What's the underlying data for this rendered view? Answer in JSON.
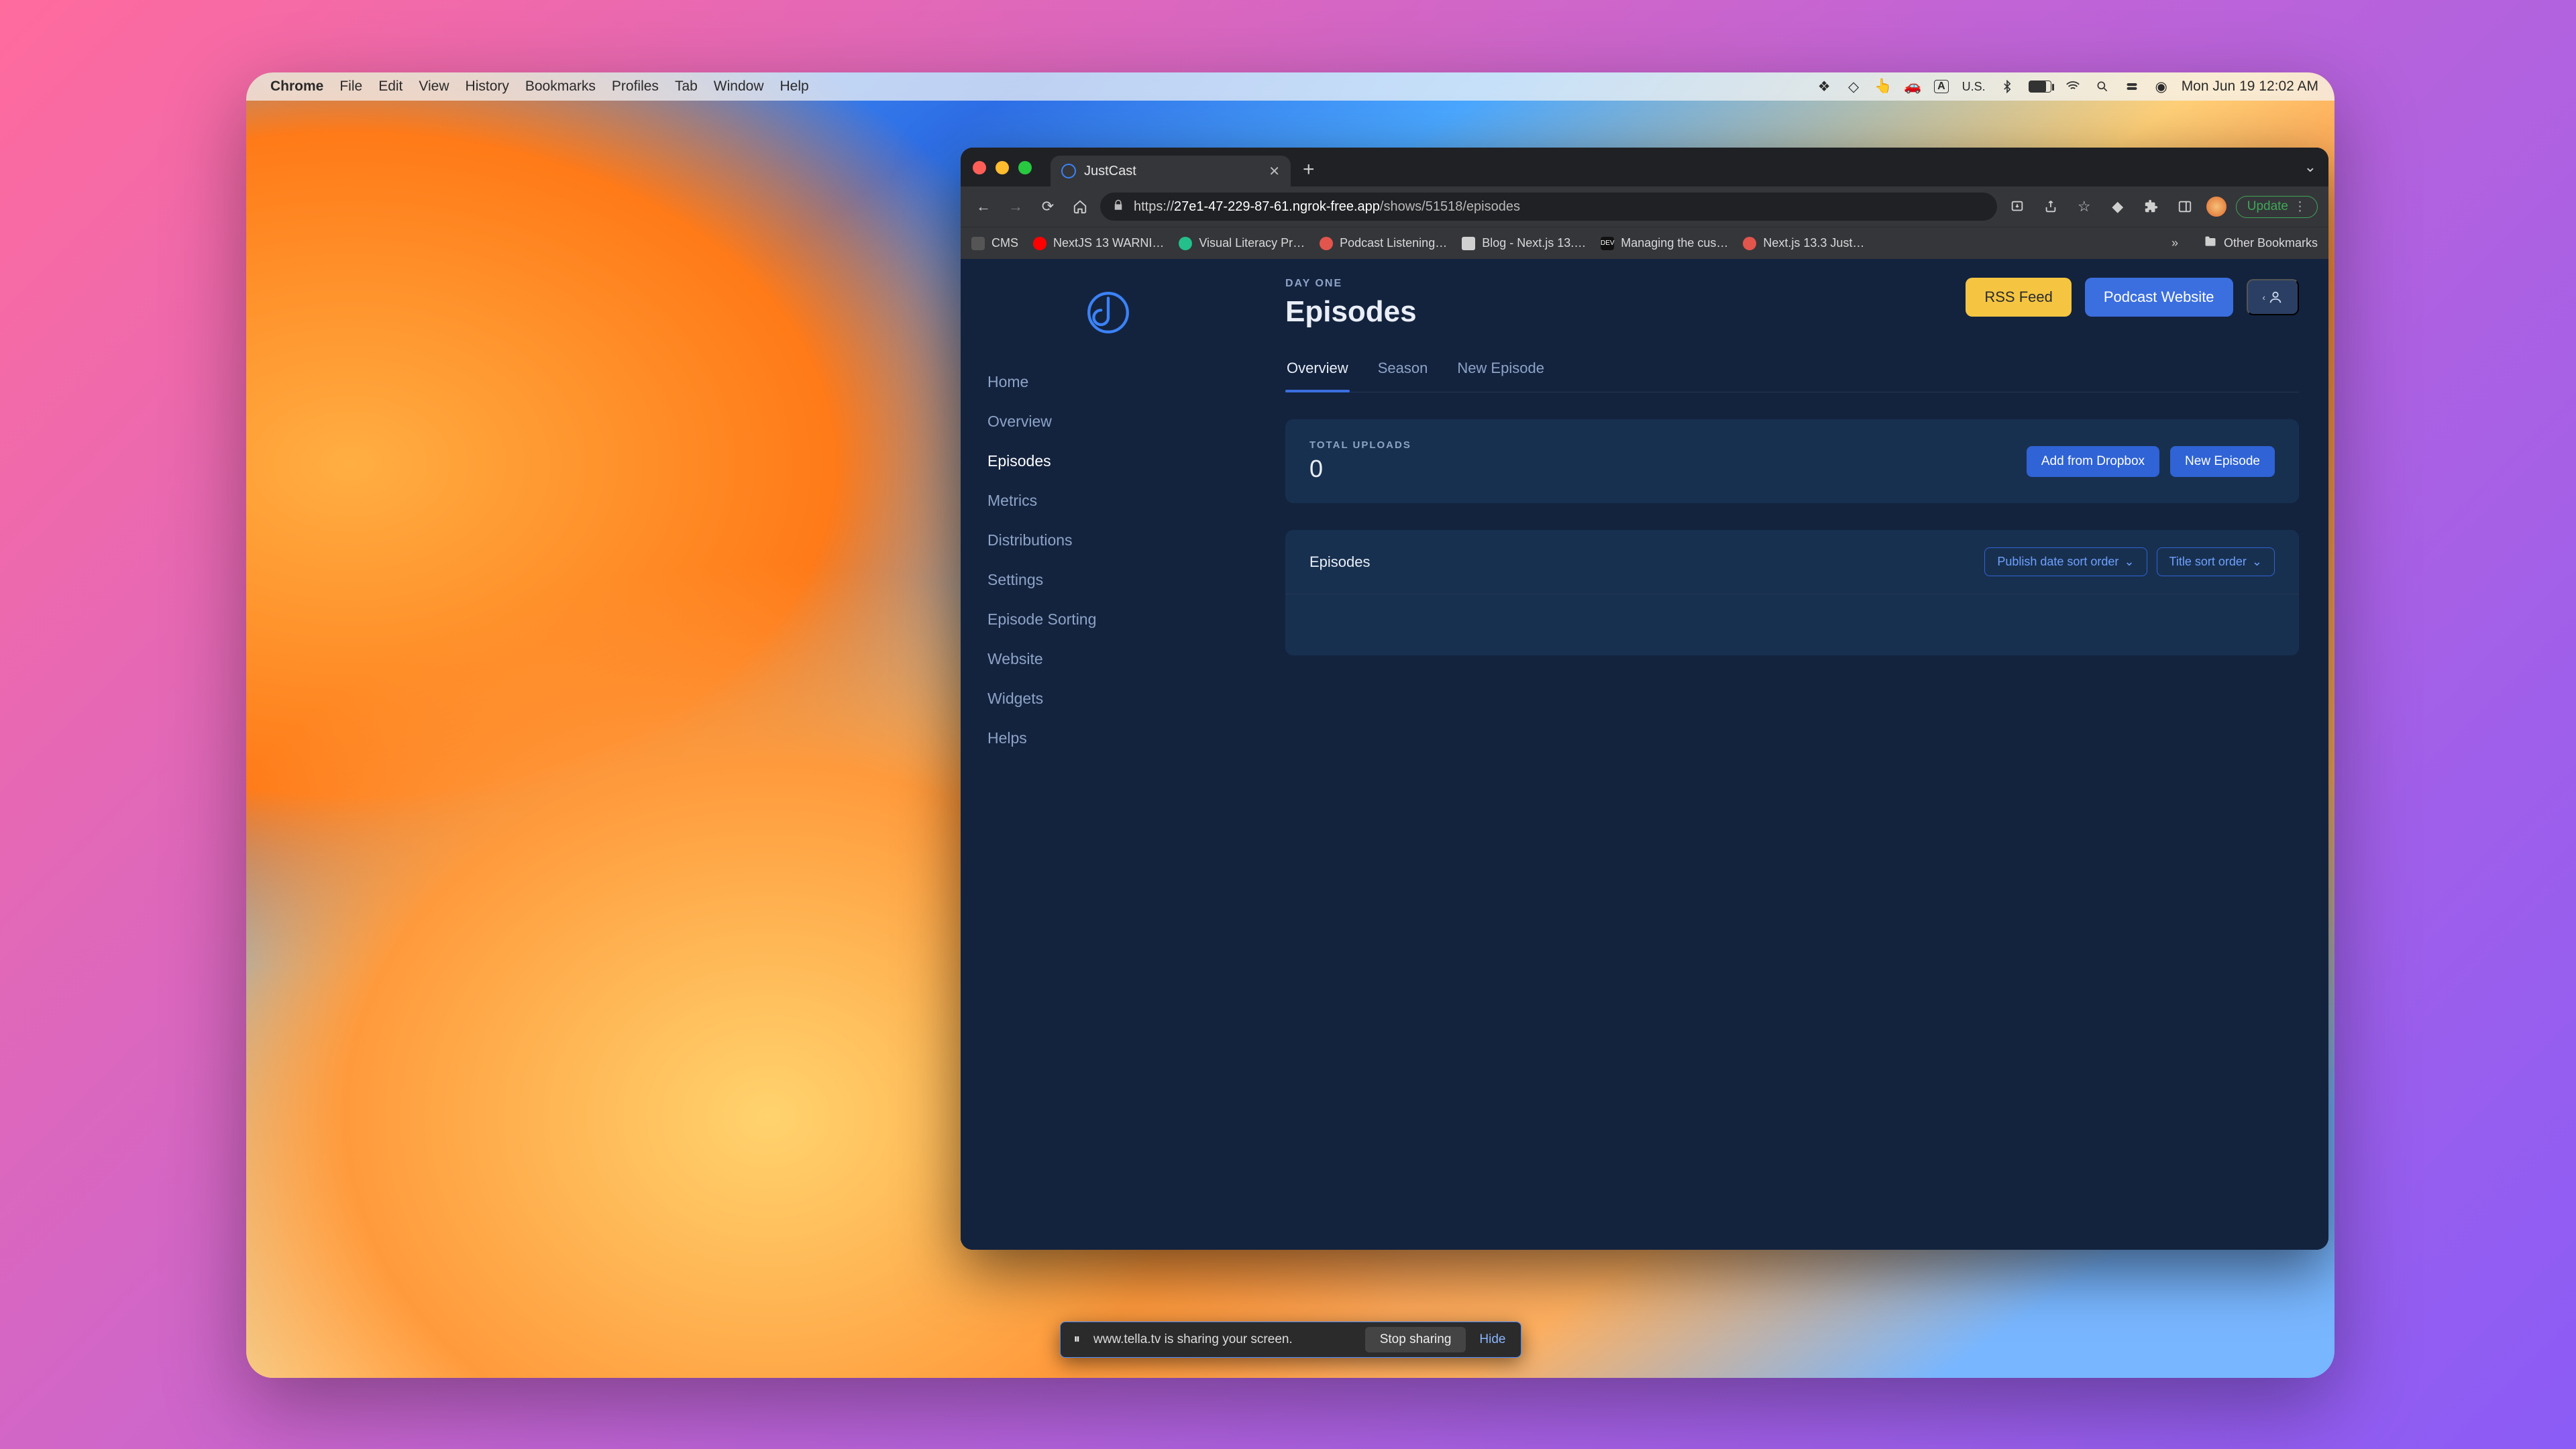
{
  "mac_menu": {
    "app": "Chrome",
    "items": [
      "File",
      "Edit",
      "View",
      "History",
      "Bookmarks",
      "Profiles",
      "Tab",
      "Window",
      "Help"
    ],
    "input_badge": "A",
    "locale": "U.S.",
    "datetime": "Mon Jun 19  12:02 AM"
  },
  "browser": {
    "tab_title": "JustCast",
    "url_scheme": "https://",
    "url_host": "27e1-47-229-87-61.ngrok-free.app",
    "url_path": "/shows/51518/episodes",
    "update_label": "Update",
    "bookmarks": [
      {
        "label": "CMS",
        "color": "#555"
      },
      {
        "label": "NextJS 13 WARNI…",
        "color": "#ff0000"
      },
      {
        "label": "Visual Literacy Pr…",
        "color": "#24c08b"
      },
      {
        "label": "Podcast Listening…",
        "color": "#e2554d"
      },
      {
        "label": "Blog - Next.js 13.…",
        "color": "#d0d0d0"
      },
      {
        "label": "Managing the cus…",
        "color": "#111"
      },
      {
        "label": "Next.js 13.3 Just…",
        "color": "#e2554d"
      }
    ],
    "other_bookmarks": "Other Bookmarks"
  },
  "sidebar": {
    "items": [
      "Home",
      "Overview",
      "Episodes",
      "Metrics",
      "Distributions",
      "Settings",
      "Episode Sorting",
      "Website",
      "Widgets",
      "Helps"
    ],
    "active_index": 2
  },
  "page": {
    "eyebrow": "DAY ONE",
    "title": "Episodes",
    "rss_label": "RSS Feed",
    "podcast_website_label": "Podcast Website"
  },
  "tabs": {
    "items": [
      "Overview",
      "Season",
      "New Episode"
    ],
    "active_index": 0
  },
  "uploads": {
    "label": "TOTAL UPLOADS",
    "count": "0",
    "add_dropbox": "Add from Dropbox",
    "new_episode": "New Episode"
  },
  "episodes": {
    "title": "Episodes",
    "sort_publish": "Publish date sort order",
    "sort_title": "Title sort order"
  },
  "share_bar": {
    "message": "www.tella.tv is sharing your screen.",
    "stop": "Stop sharing",
    "hide": "Hide"
  }
}
